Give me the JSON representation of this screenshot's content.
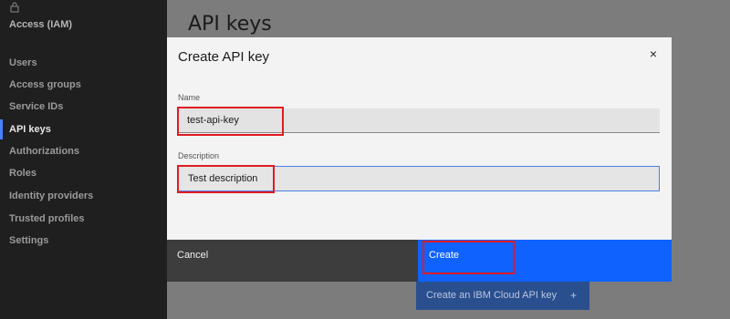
{
  "sidebar": {
    "title": "Access (IAM)",
    "items": [
      {
        "label": "Users"
      },
      {
        "label": "Access groups"
      },
      {
        "label": "Service IDs"
      },
      {
        "label": "API keys"
      },
      {
        "label": "Authorizations"
      },
      {
        "label": "Roles"
      },
      {
        "label": "Identity providers"
      },
      {
        "label": "Trusted profiles"
      },
      {
        "label": "Settings"
      }
    ],
    "active_item": "API keys",
    "icon": "lock-icon"
  },
  "page": {
    "title": "API keys",
    "background_button_label": "Create an IBM Cloud API key",
    "background_button_icon": "+"
  },
  "modal": {
    "title": "Create API key",
    "close_icon": "×",
    "name_label": "Name",
    "name_value": "test-api-key",
    "description_label": "Description",
    "description_value": "Test description",
    "cancel_label": "Cancel",
    "create_label": "Create"
  },
  "colors": {
    "primary": "#0f62fe",
    "highlight": "#e01b22",
    "sidebar_bg": "#1f1f1f"
  }
}
